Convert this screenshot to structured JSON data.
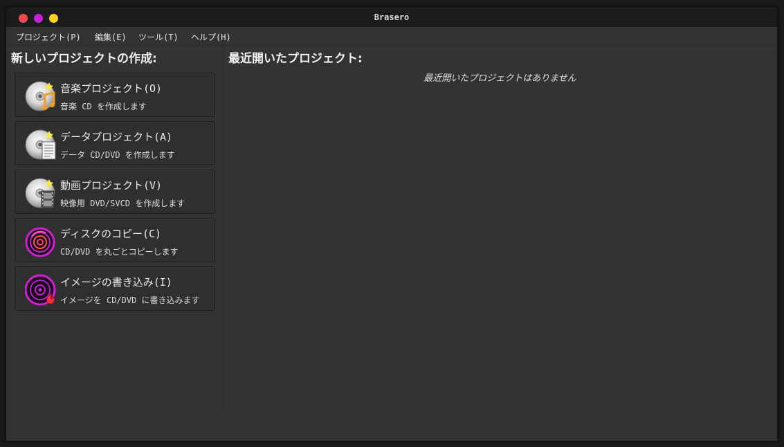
{
  "window": {
    "title": "Brasero"
  },
  "menubar": {
    "items": [
      {
        "label": "プロジェクト(P)"
      },
      {
        "label": "編集(E)"
      },
      {
        "label": "ツール(T)"
      },
      {
        "label": "ヘルプ(H)"
      }
    ]
  },
  "new_project": {
    "heading": "新しいプロジェクトの作成:",
    "buttons": [
      {
        "label": "音楽プロジェクト(O)",
        "description": "音楽 CD を作成します",
        "icon": "audio-disc-icon"
      },
      {
        "label": "データプロジェクト(A)",
        "description": "データ CD/DVD を作成します",
        "icon": "data-disc-icon"
      },
      {
        "label": "動画プロジェクト(V)",
        "description": "映像用 DVD/SVCD を作成します",
        "icon": "video-disc-icon"
      },
      {
        "label": "ディスクのコピー(C)",
        "description": "CD/DVD を丸ごとコピーします",
        "icon": "disc-copy-icon"
      },
      {
        "label": "イメージの書き込み(I)",
        "description": "イメージを CD/DVD に書き込みます",
        "icon": "image-burn-icon"
      }
    ]
  },
  "recent": {
    "heading": "最近開いたプロジェクト:",
    "empty_message": "最近開いたプロジェクトはありません"
  },
  "colors": {
    "window_bg": "#333333",
    "titlebar_bg": "#1c1c1c",
    "close": "#f2494c",
    "minimize": "#c81fd8",
    "maximize": "#ffd21f",
    "accent_magenta": "#d21fd6"
  }
}
